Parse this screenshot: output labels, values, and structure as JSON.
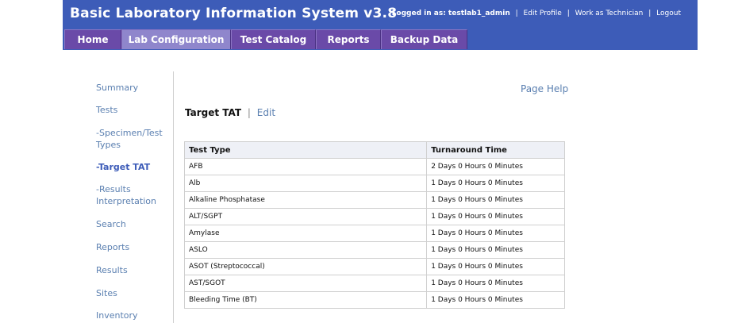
{
  "header": {
    "title": "Basic Laboratory Information System v3.8",
    "logged_in_label": "Logged in as: testlab1_admin",
    "links": [
      "Edit Profile",
      "Work as Technician",
      "Logout"
    ],
    "colors": {
      "header_bg": "#3d5cb8",
      "tab_bg": "#6a4aa8",
      "tab_active_bg": "#8f86cc"
    }
  },
  "tabs": [
    {
      "label": "Home",
      "active": false
    },
    {
      "label": "Lab Configuration",
      "active": true
    },
    {
      "label": "Test Catalog",
      "active": false
    },
    {
      "label": "Reports",
      "active": false
    },
    {
      "label": "Backup Data",
      "active": false
    }
  ],
  "sidebar": {
    "items": [
      {
        "label": "Summary"
      },
      {
        "label": "Tests"
      },
      {
        "label": "-Specimen/Test Types"
      },
      {
        "label": "-Target TAT",
        "current": true
      },
      {
        "label": "-Results Interpretation"
      },
      {
        "label": "Search"
      },
      {
        "label": "Reports"
      },
      {
        "label": "Results"
      },
      {
        "label": "Sites"
      },
      {
        "label": "Inventory"
      }
    ]
  },
  "main": {
    "page_help": "Page Help",
    "section_title": "Target TAT",
    "separator": "|",
    "edit_link": "Edit",
    "table": {
      "columns": [
        "Test Type",
        "Turnaround Time"
      ],
      "rows": [
        [
          "AFB",
          "2 Days 0 Hours 0 Minutes"
        ],
        [
          "Alb",
          "1 Days 0 Hours 0 Minutes"
        ],
        [
          "Alkaline Phosphatase",
          "1 Days 0 Hours 0 Minutes"
        ],
        [
          "ALT/SGPT",
          "1 Days 0 Hours 0 Minutes"
        ],
        [
          "Amylase",
          "1 Days 0 Hours 0 Minutes"
        ],
        [
          "ASLO",
          "1 Days 0 Hours 0 Minutes"
        ],
        [
          "ASOT (Streptococcal)",
          "1 Days 0 Hours 0 Minutes"
        ],
        [
          "AST/SGOT",
          "1 Days 0 Hours 0 Minutes"
        ],
        [
          "Bleeding Time (BT)",
          "1 Days 0 Hours 0 Minutes"
        ]
      ]
    }
  }
}
